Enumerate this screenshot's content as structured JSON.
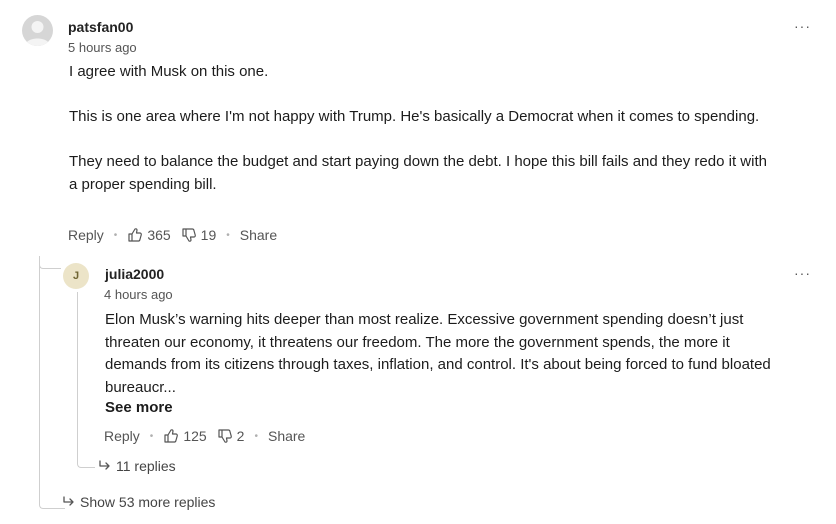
{
  "comments": [
    {
      "author": "patsfan00",
      "time": "5 hours ago",
      "paragraphs": [
        "I agree with Musk on this one.",
        "This is one area where I'm not happy with Trump. He's basically a Democrat when it comes to spending.",
        "They need to balance the budget and start paying down the debt. I hope this bill fails and they redo it with a proper spending bill."
      ],
      "actions": {
        "reply": "Reply",
        "likes": "365",
        "dislikes": "19",
        "share": "Share"
      },
      "more_menu": "···"
    },
    {
      "author": "julia2000",
      "avatar_initial": "J",
      "time": "4 hours ago",
      "text": "Elon Musk’s warning hits deeper than most realize. Excessive government spending doesn’t just threaten our economy, it threatens our freedom. The more the government spends, the more it demands from its citizens through taxes, inflation, and control. It's about being forced to fund bloated bureaucr...",
      "see_more": "See more",
      "actions": {
        "reply": "Reply",
        "likes": "125",
        "dislikes": "2",
        "share": "Share"
      },
      "more_menu": "···",
      "replies_link": "11 replies"
    }
  ],
  "show_more_replies": "Show 53 more replies",
  "icons": [
    "like-icon",
    "dislike-icon",
    "reply-arrow-icon",
    "more-icon",
    "user-avatar-icon"
  ]
}
